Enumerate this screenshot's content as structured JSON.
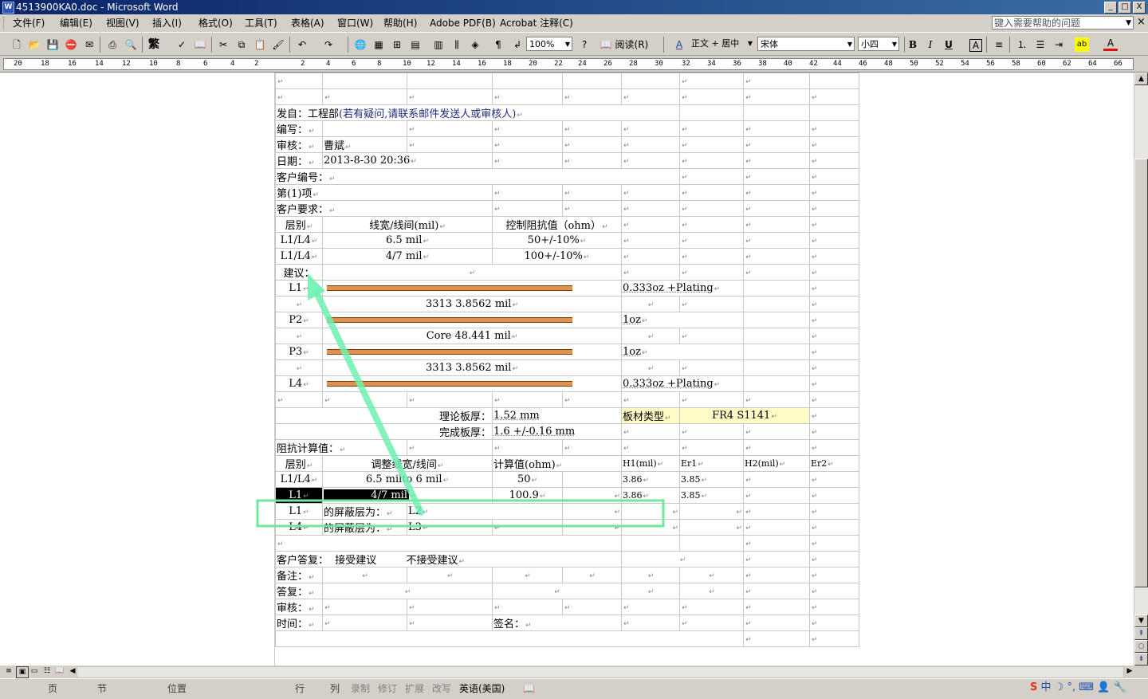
{
  "window": {
    "title": "4513900KA0.doc - Microsoft Word",
    "controls": [
      "_",
      "□",
      "X"
    ]
  },
  "menu": {
    "items": [
      "文件(F)",
      "编辑(E)",
      "视图(V)",
      "插入(I)",
      "格式(O)",
      "工具(T)",
      "表格(A)",
      "窗口(W)",
      "帮助(H)",
      "Adobe PDF(B)",
      "Acrobat 注释(C)"
    ],
    "help_placeholder": "键入需要帮助的问题",
    "close_doc": "×"
  },
  "toolbar": {
    "zoom": "100%",
    "read_label": "阅读(R)",
    "style": "正文 + 居中",
    "font": "宋体",
    "size": "小四",
    "traditional_label": "繁",
    "bold": "B",
    "italic": "I",
    "underline": "U",
    "charborder": "A",
    "fontcolor": "A",
    "style_icon": "A",
    "highlight": "ab",
    "icons": [
      "new-icon",
      "open-icon",
      "save-icon",
      "permission-icon",
      "email-icon",
      "print-icon",
      "print-preview-icon",
      "spelling-icon",
      "research-icon",
      "cut-icon",
      "copy-icon",
      "paste-icon",
      "format-painter-icon",
      "undo-icon",
      "redo-icon",
      "hyperlink-icon",
      "tables-borders-icon",
      "insert-table-icon",
      "insert-excel-icon",
      "columns-icon",
      "drawing-icon",
      "document-map-icon",
      "show-hide-icon",
      "help-icon"
    ]
  },
  "ruler": {
    "left_ticks": [
      "20",
      "18",
      "16",
      "14",
      "12",
      "10",
      "8",
      "6",
      "4",
      "2"
    ],
    "right_ticks": [
      "2",
      "4",
      "6",
      "8",
      "10",
      "12",
      "14",
      "16",
      "18",
      "20",
      "22",
      "24",
      "26",
      "28",
      "30",
      "32",
      "34",
      "36",
      "38",
      "40",
      "42",
      "44",
      "46",
      "48",
      "50",
      "52",
      "54",
      "56",
      "58",
      "60",
      "62",
      "64",
      "66"
    ]
  },
  "doc": {
    "mark": "↵",
    "from_label": "发自：工程部",
    "from_note": "(若有疑问,请联系邮件发送人或审核人)",
    "author_label": "编写：",
    "review_label": "审核：",
    "reviewer": "曹斌",
    "date_label": "日期：",
    "date": "2013-8-30 20:36",
    "cust_no_label": "客户编号：",
    "item_label": "第(1)项",
    "cust_req_label": "客户要求：",
    "req_headers": [
      "层别",
      "线宽/线间(mil)",
      "控制阻抗值（ohm）"
    ],
    "req_rows": [
      {
        "layer": "L1/L4",
        "width": "6.5 mil",
        "imp": "50+/-10%"
      },
      {
        "layer": "L1/L4",
        "width": "4/7 mil",
        "imp": "100+/-10%"
      }
    ],
    "suggest_label": "建议：",
    "stack": [
      {
        "kind": "layer",
        "label": "L1",
        "note": "0.333oz +Plating"
      },
      {
        "kind": "dielectric",
        "text": "3313    3.8562 mil"
      },
      {
        "kind": "layer",
        "label": "P2",
        "note": "1oz"
      },
      {
        "kind": "dielectric",
        "text": "Core   48.441 mil"
      },
      {
        "kind": "layer",
        "label": "P3",
        "note": "1oz"
      },
      {
        "kind": "dielectric",
        "text": "3313    3.8562 mil"
      },
      {
        "kind": "layer",
        "label": "L4",
        "note": "0.333oz +Plating"
      }
    ],
    "theory_thk_label": "理论板厚：",
    "theory_thk": "1.52 mm",
    "board_type_label": "板材类型",
    "board_type": "FR4 S1141",
    "finish_thk_label": "完成板厚：",
    "finish_thk": "1.6 +/-0.16 mm",
    "calc_label": "阻抗计算值：",
    "calc_headers": [
      "层别",
      "调整线宽/线间",
      "计算值(ohm)",
      "H1(mil)",
      "Er1",
      "H2(mil)",
      "Er2"
    ],
    "calc_rows": [
      {
        "layer": "L1/L4",
        "width": "6.5 milto 6 mil",
        "val": "50",
        "h1": "3.86",
        "er1": "3.85"
      },
      {
        "layer": "L1",
        "width": "4/7 mil",
        "val": "100.9",
        "h1": "3.86",
        "er1": "3.85"
      }
    ],
    "shield_rows": [
      {
        "layer": "L1",
        "label": "的屏蔽层为：",
        "ref": "L2"
      },
      {
        "layer": "L4",
        "label": "的屏蔽层为：",
        "ref": "L3"
      }
    ],
    "reply_label": "客户答复：",
    "accept": "接受建议",
    "reject": "不接受建议",
    "note_label": "备注：",
    "answer_label": "答复：",
    "review2_label": "审核：",
    "time_label": "时间：",
    "sign_label": "签名："
  },
  "status": {
    "page": "页",
    "section": "节",
    "position": "位置",
    "line": "行",
    "col": "列",
    "rec": "录制",
    "trk": "修订",
    "ext": "扩展",
    "ovr": "改写",
    "lang": "英语(美国)"
  },
  "tray": {
    "ime": "中",
    "s": "S"
  },
  "colors": {
    "annotation_arrow": "#6ef0b0",
    "highlight_box": "#6ee89a",
    "title_gradient_start": "#0a246a",
    "copper_bar": "#e0924a",
    "yellow_cell": "#fffcc8"
  }
}
